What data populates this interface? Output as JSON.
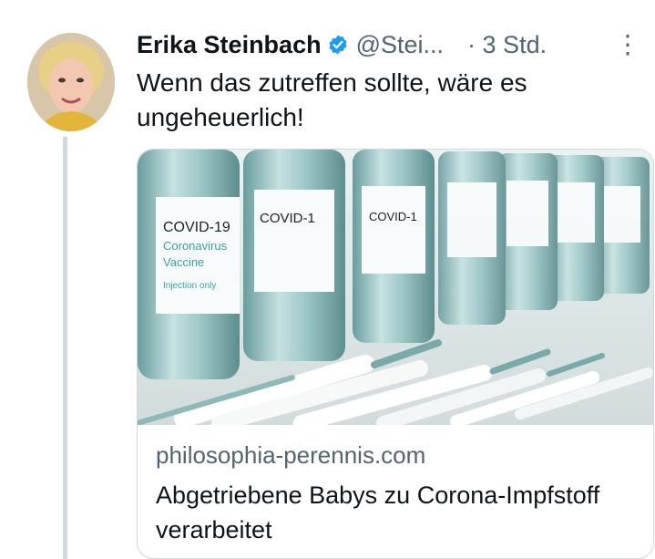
{
  "tweet": {
    "author_name": "Erika Steinbach",
    "handle": "@Stei...",
    "time": "· 3 Std.",
    "text": "Wenn das zutreffen sollte, wäre es ungeheuerlich!"
  },
  "card": {
    "domain": "philosophia-perennis.com",
    "title": "Abgetriebene Babys zu Corona-Impfstoff verarbeitet",
    "image_labels": {
      "vial_title": "COVID-19",
      "vial_line1": "Coronavirus",
      "vial_line2": "Vaccine",
      "vial_line3": "Injection only"
    }
  },
  "icons": {
    "verified": "verified-badge-icon",
    "more": "more-options-icon"
  },
  "colors": {
    "verified_blue": "#1d9bf0",
    "secondary_text": "#536471",
    "border": "#cfd9de"
  }
}
